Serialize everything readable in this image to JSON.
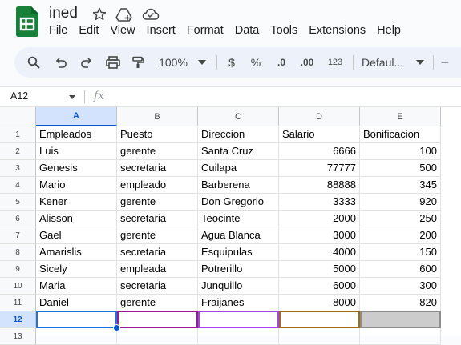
{
  "app": {
    "doc_title": "ined",
    "menu": [
      "File",
      "Edit",
      "View",
      "Insert",
      "Format",
      "Data",
      "Tools",
      "Extensions",
      "Help"
    ],
    "logo_color": "#188038"
  },
  "toolbar": {
    "zoom": "100%",
    "currency": "$",
    "percent": "%",
    "dec_decrease": ".0",
    "dec_increase": ".00",
    "number_format": "123",
    "font": "Defaul...",
    "minus": "–"
  },
  "formula_bar": {
    "name_box": "A12",
    "fx": "fx",
    "value": ""
  },
  "sheet": {
    "columns": [
      "A",
      "B",
      "C",
      "D",
      "E"
    ],
    "row_numbers": [
      "1",
      "2",
      "3",
      "4",
      "5",
      "6",
      "7",
      "8",
      "9",
      "10",
      "11",
      "12",
      "13"
    ],
    "selected_col": "A",
    "selected_row": "12",
    "rows": [
      [
        "Empleados",
        "Puesto",
        "Direccion",
        "Salario",
        "Bonificacion"
      ],
      [
        "Luis",
        "gerente",
        "Santa Cruz",
        "6666",
        "100"
      ],
      [
        "Genesis",
        "secretaria",
        "Cuilapa",
        "77777",
        "500"
      ],
      [
        "Mario",
        "empleado",
        "Barberena",
        "88888",
        "345"
      ],
      [
        "Kener",
        "gerente",
        "Don Gregorio",
        "3333",
        "920"
      ],
      [
        "Alisson",
        "secretaria",
        "Teocinte",
        "2000",
        "250"
      ],
      [
        "Gael",
        "gerente",
        "Agua Blanca",
        "3000",
        "200"
      ],
      [
        "Amarislis",
        "secretaria",
        "Esquipulas",
        "4000",
        "150"
      ],
      [
        "Sicely",
        "empleada",
        "Potrerillo",
        "5000",
        "600"
      ],
      [
        "Maria",
        "secretaria",
        "Junquillo",
        "6000",
        "300"
      ],
      [
        "Daniel",
        "gerente",
        "Fraijanes",
        "8000",
        "820"
      ],
      [
        "",
        "",
        "",
        "",
        ""
      ],
      [
        "",
        "",
        "",
        "",
        ""
      ]
    ],
    "row12_cell_borders": [
      "#1a73e8",
      "#9e1a8f",
      "#a142f4",
      "#9c6b1a",
      "#8d8d8d"
    ],
    "row12_e_fill": "#cccccc"
  }
}
